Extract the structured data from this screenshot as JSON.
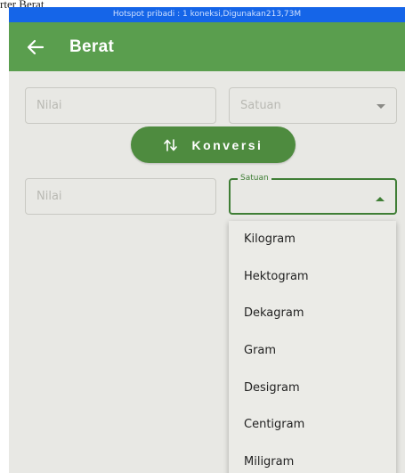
{
  "page_caption": "rter Berat",
  "status_bar": {
    "text": "Hotspot pribadi : 1 koneksi,Digunakan213,73M"
  },
  "app_bar": {
    "title": "Berat"
  },
  "input_section": {
    "value_placeholder": "Nilai",
    "unit_placeholder": "Satuan"
  },
  "convert_button": {
    "label": "Konversi"
  },
  "output_section": {
    "value_placeholder": "Nilai",
    "unit_label": "Satuan"
  },
  "unit_menu": {
    "items": [
      "Kilogram",
      "Hektogram",
      "Dekagram",
      "Gram",
      "Desigram",
      "Centigram",
      "Miligram"
    ]
  },
  "colors": {
    "app_bar": "#5a9e4e",
    "status_bar": "#1565e8",
    "accent": "#3f7e35",
    "button": "#4e8b3f",
    "background": "#e8e8e4"
  }
}
